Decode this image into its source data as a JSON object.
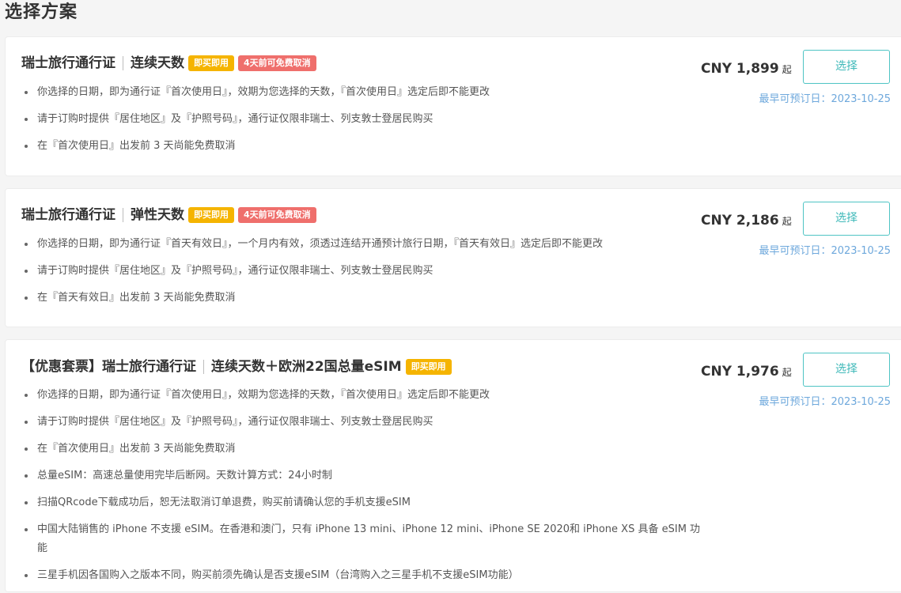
{
  "page": {
    "title": "选择方案"
  },
  "plans": [
    {
      "name": "瑞士旅行通行证",
      "variant": "连续天数",
      "badges": [
        "即买即用",
        "4天前可免费取消"
      ],
      "bullets": [
        "你选择的日期，即为通行证『首次使用日』，效期为您选择的天数，『首次使用日』选定后即不能更改",
        "请于订购时提供『居住地区』及『护照号码』，通行证仅限非瑞士、列支敦士登居民购买",
        "在『首次使用日』出发前 3 天尚能免费取消"
      ],
      "price": "CNY 1,899",
      "price_suffix": "起",
      "select_label": "选择",
      "earliest": "最早可预订日：2023-10-25"
    },
    {
      "name": "瑞士旅行通行证",
      "variant": "弹性天数",
      "badges": [
        "即买即用",
        "4天前可免费取消"
      ],
      "bullets": [
        "你选择的日期，即为通行证『首天有效日』，一个月内有效，须透过连结开通预计旅行日期，『首天有效日』选定后即不能更改",
        "请于订购时提供『居住地区』及『护照号码』，通行证仅限非瑞士、列支敦士登居民购买",
        "在『首天有效日』出发前 3 天尚能免费取消"
      ],
      "price": "CNY 2,186",
      "price_suffix": "起",
      "select_label": "选择",
      "earliest": "最早可预订日：2023-10-25"
    },
    {
      "name": "【优惠套票】瑞士旅行通行证",
      "variant": "连续天数＋欧洲22国总量eSIM",
      "badges": [
        "即买即用"
      ],
      "bullets": [
        "你选择的日期，即为通行证『首次使用日』，效期为您选择的天数，『首次使用日』选定后即不能更改",
        "请于订购时提供『居住地区』及『护照号码』，通行证仅限非瑞士、列支敦士登居民购买",
        "在『首次使用日』出发前 3 天尚能免费取消",
        "总量eSIM：高速总量使用完毕后断网。天数计算方式：24小时制",
        "扫描QRcode下载成功后，恕无法取消订单退费，购买前请确认您的手机支援eSIM",
        "中国大陆销售的 iPhone 不支援 eSIM。在香港和澳门，只有 iPhone 13 mini、iPhone 12 mini、iPhone SE 2020和 iPhone XS 具备 eSIM 功能",
        "三星手机因各国购入之版本不同，购买前须先确认是否支援eSIM（台湾购入之三星手机不支援eSIM功能）"
      ],
      "price": "CNY 1,976",
      "price_suffix": "起",
      "select_label": "选择",
      "earliest": "最早可预订日：2023-10-25"
    }
  ]
}
